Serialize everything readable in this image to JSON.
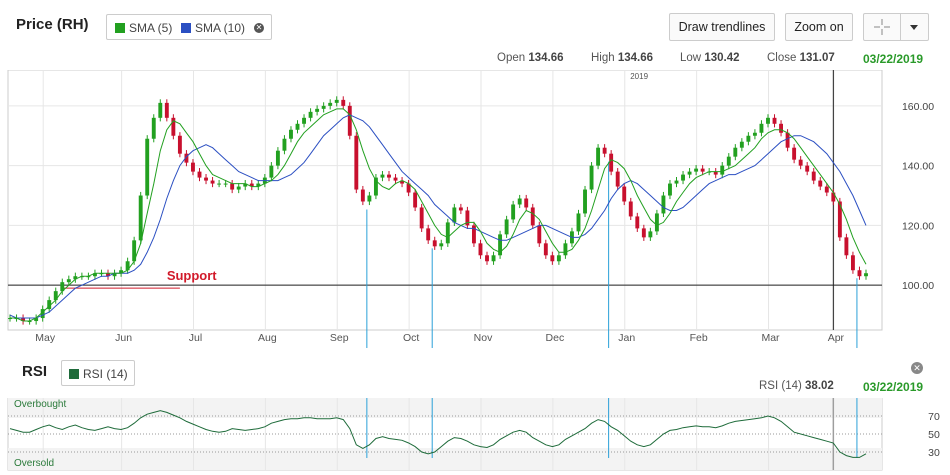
{
  "header": {
    "title": "Price (RH)",
    "legend": [
      {
        "label": "SMA (5)",
        "color": "#22a020"
      },
      {
        "label": "SMA (10)",
        "color": "#2b4fc2"
      }
    ],
    "draw_trendlines": "Draw trendlines",
    "zoom_on": "Zoom on",
    "ohlc": {
      "open_label": "Open",
      "open": "134.66",
      "high_label": "High",
      "high": "134.66",
      "low_label": "Low",
      "low": "130.42",
      "close_label": "Close",
      "close": "131.07"
    },
    "date": "03/22/2019"
  },
  "rsi_panel": {
    "title": "RSI",
    "legend": {
      "label": "RSI (14)",
      "color": "#1e6b3a"
    },
    "readout_label": "RSI (14)",
    "readout_value": "38.02",
    "date": "03/22/2019",
    "overbought": "Overbought",
    "oversold": "Oversold"
  },
  "colors": {
    "up": "#22a020",
    "down": "#c8102e",
    "sma5": "#22a020",
    "sma10": "#2b4fc2",
    "rsi": "#1e6b3a",
    "annotation": "#d11a2a",
    "marker_line": "#2aa0d8"
  },
  "chart_data": [
    {
      "type": "line",
      "title": "",
      "ylim": [
        85,
        172
      ],
      "y_ticks": [
        100,
        120,
        140,
        160
      ],
      "y_tick_labels": [
        "100.00",
        "120.00",
        "140.00",
        "160.00"
      ],
      "x_tick_labels": [
        "May",
        "Jun",
        "Jul",
        "Aug",
        "Sep",
        "Oct",
        "Nov",
        "Dec",
        "Jan",
        "Feb",
        "Mar",
        "Apr"
      ],
      "year_label": "2019",
      "horizontal_line": 100,
      "annotation": {
        "text": "Support",
        "y": 99
      },
      "grid": true,
      "series": [
        {
          "name": "Price",
          "values": [
            89,
            89,
            88,
            88,
            89,
            92,
            95,
            98,
            101,
            102,
            103,
            103,
            103,
            104,
            104,
            103,
            104,
            105,
            108,
            115,
            130,
            149,
            156,
            161,
            156,
            150,
            144,
            141,
            138,
            136,
            135,
            134,
            134,
            134,
            132,
            133,
            134,
            133,
            134,
            136,
            140,
            145,
            149,
            152,
            154,
            156,
            158,
            159,
            160,
            161,
            162,
            160,
            150,
            132,
            128,
            130,
            136,
            137,
            136,
            135,
            134,
            131,
            126,
            119,
            115,
            113,
            114,
            121,
            126,
            125,
            120,
            114,
            110,
            108,
            110,
            117,
            122,
            127,
            129,
            126,
            120,
            114,
            110,
            108,
            110,
            114,
            118,
            124,
            132,
            140,
            146,
            144,
            138,
            133,
            128,
            123,
            119,
            116,
            118,
            124,
            130,
            134,
            135,
            137,
            138,
            139,
            138,
            138,
            137,
            140,
            143,
            146,
            148,
            150,
            151,
            154,
            156,
            154,
            151,
            146,
            142,
            140,
            138,
            135,
            133,
            131,
            128,
            116,
            110,
            105,
            103,
            104
          ]
        },
        {
          "name": "SMA (5)",
          "values": [
            89,
            89,
            88,
            88,
            89,
            91,
            93,
            95,
            98,
            100,
            102,
            103,
            103,
            104,
            104,
            104,
            104,
            104,
            105,
            108,
            114,
            124,
            134,
            145,
            152,
            155,
            154,
            151,
            148,
            144,
            140,
            137,
            136,
            135,
            134,
            134,
            134,
            133,
            133,
            134,
            135,
            137,
            140,
            144,
            148,
            151,
            153,
            155,
            157,
            158,
            159,
            159,
            157,
            152,
            145,
            139,
            135,
            133,
            132,
            134,
            135,
            134,
            132,
            128,
            124,
            120,
            117,
            116,
            118,
            120,
            121,
            121,
            118,
            114,
            112,
            111,
            113,
            117,
            122,
            125,
            124,
            122,
            118,
            114,
            111,
            111,
            112,
            115,
            119,
            125,
            132,
            139,
            142,
            141,
            139,
            135,
            130,
            126,
            122,
            120,
            121,
            124,
            128,
            131,
            134,
            136,
            137,
            138,
            138,
            138,
            139,
            140,
            142,
            144,
            146,
            149,
            151,
            152,
            152,
            151,
            149,
            146,
            143,
            140,
            137,
            134,
            131,
            127,
            122,
            116,
            111,
            107
          ]
        },
        {
          "name": "SMA (10)",
          "values": [
            90,
            89,
            89,
            89,
            89,
            90,
            91,
            93,
            95,
            97,
            99,
            100,
            101,
            102,
            103,
            103,
            104,
            104,
            104,
            105,
            107,
            111,
            116,
            122,
            129,
            135,
            140,
            143,
            145,
            146,
            147,
            146,
            144,
            142,
            140,
            138,
            137,
            136,
            135,
            135,
            135,
            135,
            136,
            137,
            139,
            141,
            144,
            147,
            150,
            152,
            154,
            156,
            157,
            156,
            155,
            153,
            150,
            147,
            144,
            141,
            138,
            136,
            134,
            132,
            130,
            127,
            125,
            123,
            121,
            120,
            119,
            119,
            118,
            117,
            116,
            115,
            115,
            116,
            117,
            118,
            119,
            120,
            120,
            119,
            118,
            117,
            116,
            116,
            117,
            119,
            122,
            125,
            129,
            132,
            134,
            135,
            134,
            132,
            130,
            128,
            126,
            125,
            125,
            126,
            128,
            130,
            132,
            134,
            135,
            136,
            137,
            137,
            138,
            139,
            140,
            142,
            144,
            146,
            148,
            149,
            150,
            150,
            149,
            148,
            146,
            144,
            141,
            138,
            134,
            130,
            125,
            120
          ]
        }
      ]
    },
    {
      "type": "line",
      "title": "",
      "ylim": [
        10,
        90
      ],
      "y_ticks": [
        30,
        50,
        70
      ],
      "y_tick_labels": [
        "30",
        "50",
        "70"
      ],
      "series": [
        {
          "name": "RSI (14)",
          "values": [
            56,
            54,
            52,
            52,
            55,
            58,
            60,
            57,
            55,
            58,
            60,
            57,
            55,
            54,
            56,
            58,
            56,
            55,
            57,
            62,
            68,
            72,
            74,
            76,
            74,
            71,
            68,
            64,
            61,
            58,
            55,
            53,
            52,
            53,
            56,
            55,
            54,
            55,
            56,
            58,
            62,
            64,
            66,
            67,
            67,
            68,
            68,
            67,
            67,
            67,
            68,
            66,
            56,
            38,
            34,
            38,
            45,
            47,
            45,
            44,
            43,
            40,
            36,
            30,
            28,
            30,
            36,
            42,
            46,
            45,
            42,
            38,
            36,
            35,
            38,
            44,
            48,
            52,
            54,
            52,
            46,
            42,
            38,
            36,
            38,
            44,
            48,
            52,
            56,
            62,
            66,
            64,
            58,
            54,
            48,
            42,
            38,
            36,
            38,
            44,
            50,
            54,
            55,
            57,
            58,
            59,
            58,
            58,
            57,
            59,
            62,
            64,
            65,
            66,
            67,
            68,
            70,
            68,
            64,
            58,
            52,
            50,
            48,
            46,
            44,
            42,
            40,
            30,
            26,
            24,
            24,
            28
          ]
        }
      ]
    }
  ]
}
